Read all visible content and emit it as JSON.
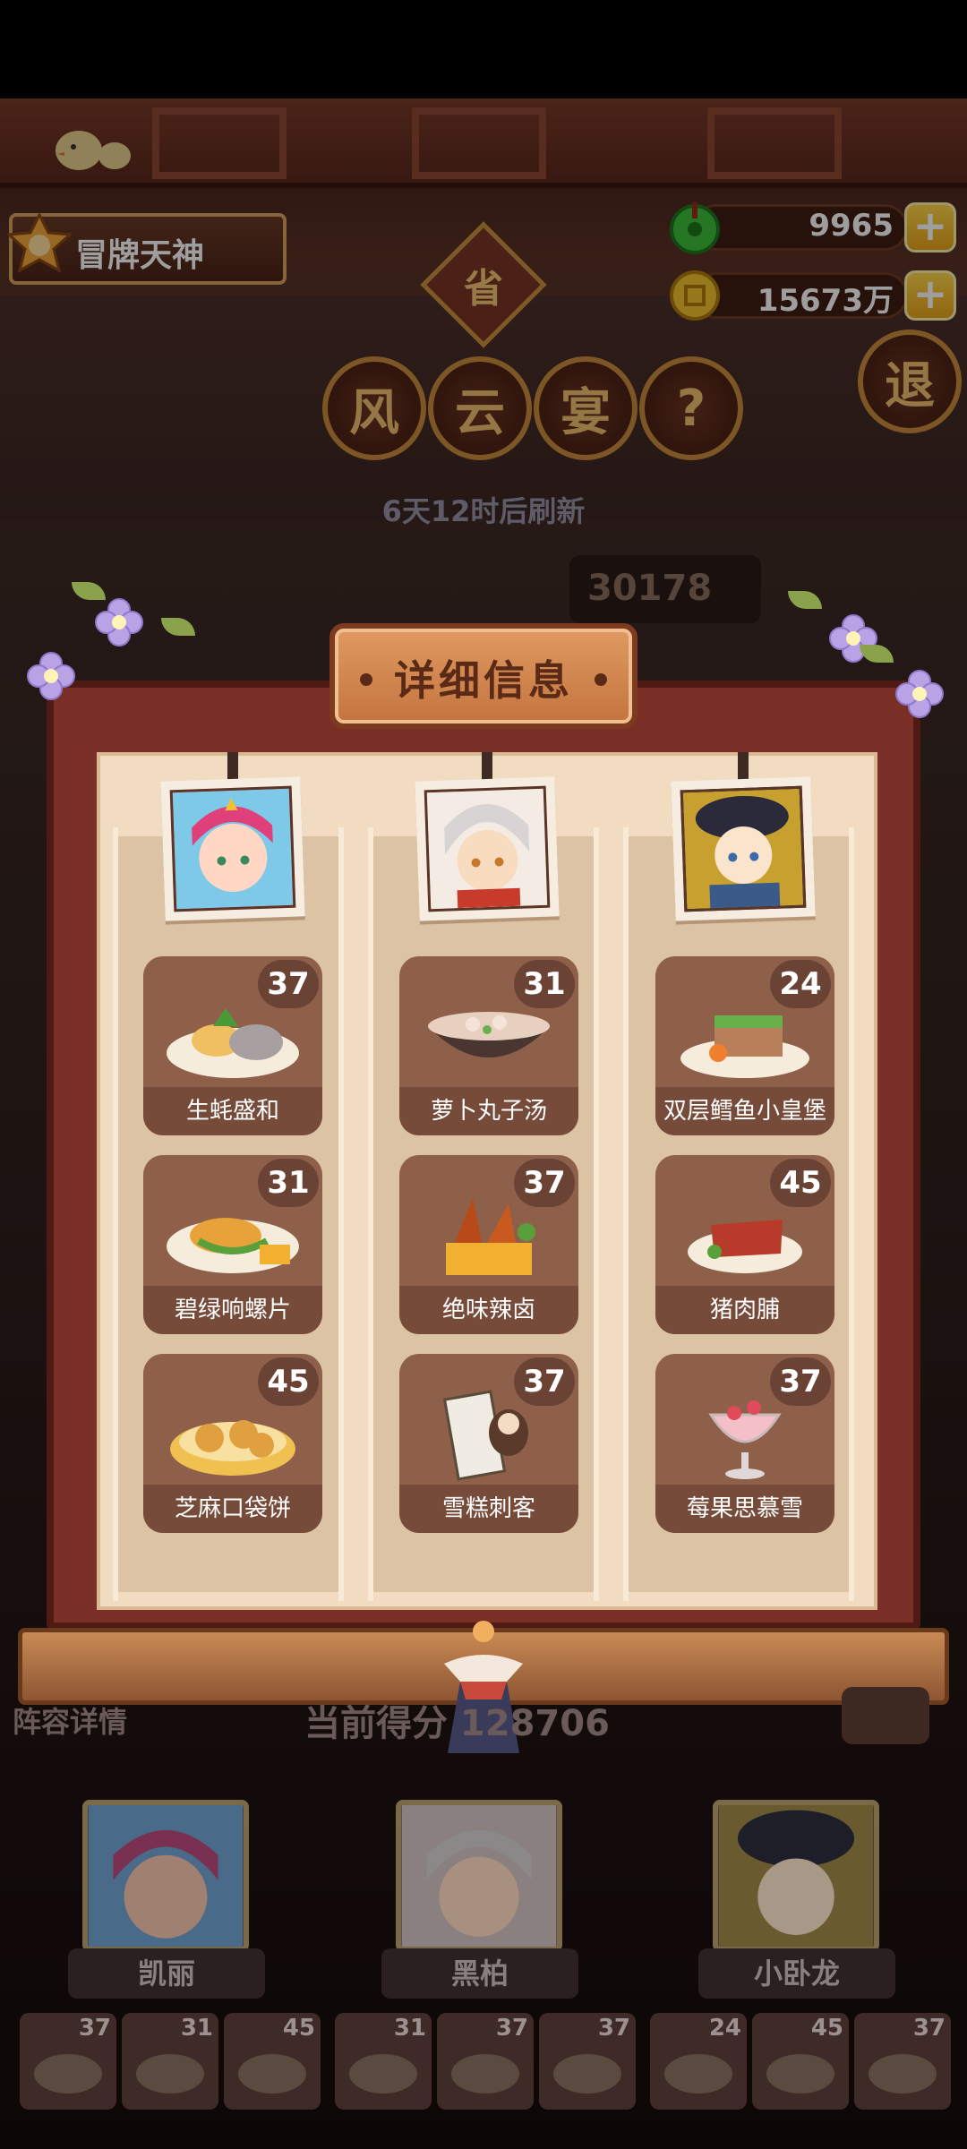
{
  "hud": {
    "player_name": "冒牌天神",
    "jade_amount": "9965",
    "coin_amount": "15673万",
    "plus_symbol": "+"
  },
  "header": {
    "seal": "省",
    "title_chars": [
      "风",
      "云",
      "宴"
    ],
    "help": "?",
    "exit": "退",
    "refresh_text": "6天12时后刷新",
    "score_partial": "30178"
  },
  "panel": {
    "title": "详细信息",
    "columns": [
      {
        "dishes": [
          {
            "name": "生蚝盛和",
            "count": "37"
          },
          {
            "name": "碧绿响螺片",
            "count": "31"
          },
          {
            "name": "芝麻口袋饼",
            "count": "45"
          }
        ]
      },
      {
        "dishes": [
          {
            "name": "萝卜丸子汤",
            "count": "31"
          },
          {
            "name": "绝味辣卤",
            "count": "37"
          },
          {
            "name": "雪糕刺客",
            "count": "37"
          }
        ]
      },
      {
        "dishes": [
          {
            "name": "双层鳕鱼小皇堡",
            "count": "24"
          },
          {
            "name": "猪肉脯",
            "count": "45"
          },
          {
            "name": "莓果思慕雪",
            "count": "37"
          }
        ]
      }
    ]
  },
  "lineup": {
    "label": "阵容详情",
    "current_score": "当前得分 128706",
    "heroes": [
      {
        "name": "凯丽"
      },
      {
        "name": "黑柏"
      },
      {
        "name": "小卧龙"
      }
    ],
    "mini_counts": [
      "37",
      "31",
      "45",
      "31",
      "37",
      "37",
      "24",
      "45",
      "37"
    ]
  },
  "colors": {
    "panel_frame": "#7a2f26",
    "panel_paper": "#f1dcc1",
    "dish_card": "#8e5f49",
    "gold_button": "#e9a41a"
  }
}
